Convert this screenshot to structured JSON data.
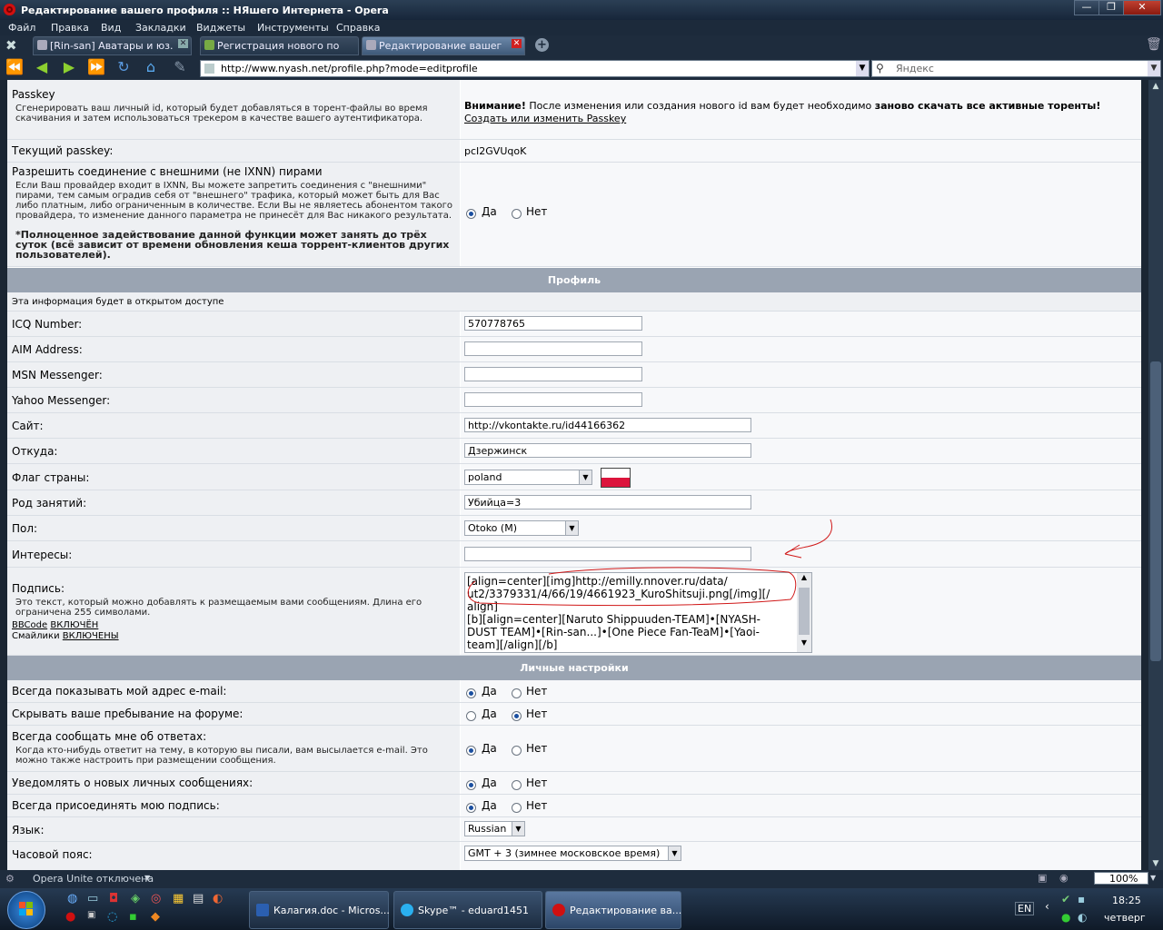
{
  "window": {
    "title": "Редактирование вашего профиля :: НЯшего Интернета - Opera"
  },
  "menu": [
    "Файл",
    "Правка",
    "Вид",
    "Закладки",
    "Виджеты",
    "Инструменты",
    "Справка"
  ],
  "tabs": [
    {
      "label": "[Rin-san] Аватары и юз..."
    },
    {
      "label": "Регистрация нового по..."
    },
    {
      "label": "Редактирование вашег..."
    }
  ],
  "address": {
    "url": "http://www.nyash.net/profile.php?mode=editprofile",
    "search_placeholder": "Яндекс"
  },
  "passkey": {
    "label": "Passkey",
    "desc": "Сгенерировать ваш личный id, который будет добавляться в торент-файлы во время скачивания и затем использоваться трекером в качестве вашего аутентификатора.",
    "warning_bold": "Внимание!",
    "warning_text": " После изменения или создания нового id вам будет необходимо ",
    "warning_bold2": "заново скачать все активные торенты!",
    "link": "Создать или изменить Passkey",
    "current_label": "Текущий passkey:",
    "current_value": "pcI2GVUqoK"
  },
  "external_peers": {
    "label": "Разрешить соединение с внешними (не IXNN) пирами",
    "desc": "Если Ваш провайдер входит в IXNN, Вы можете запретить соединения с \"внешними\" пирами, тем самым оградив себя от \"внешнего\" трафика, который может быть для Вас либо платным, либо ограниченным в количестве. Если Вы не являетесь абонентом такого провайдера, то изменение данного параметра не принесёт для Вас никакого результата.",
    "note": "*Полноценное задействование данной функции может занять до трёх суток (всё зависит от времени обновления кеша торрент-клиентов других пользователей).",
    "yes": "Да",
    "no": "Нет"
  },
  "profile": {
    "section": "Профиль",
    "public_note": "Эта информация будет в открытом доступе",
    "icq_label": "ICQ Number:",
    "icq": "570778765",
    "aim_label": "AIM Address:",
    "aim": "",
    "msn_label": "MSN Messenger:",
    "msn": "",
    "yahoo_label": "Yahoo Messenger:",
    "yahoo": "",
    "site_label": "Сайт:",
    "site": "http://vkontakte.ru/id44166362",
    "from_label": "Откуда:",
    "from": "Дзержинск",
    "flag_label": "Флаг страны:",
    "flag": "poland",
    "occ_label": "Род занятий:",
    "occ": "Убийца=3",
    "gender_label": "Пол:",
    "gender": "Otoko (M)",
    "interests_label": "Интересы:",
    "interests": "",
    "sig_label": "Подпись:",
    "sig_desc": "Это текст, который можно добавлять к размещаемым вами сообщениям. Длина его ограничена 255 символами.",
    "bbcode": "BBCode",
    "bbcode_state": "ВКЛЮЧЁН",
    "smilies": "Смайлики",
    "smilies_state": "ВКЛЮЧЕНЫ",
    "sig_lines": [
      "[align=center][img]http://emilly.nnover.ru/data/",
      "ut2/3379331/4/66/19/4661923_KuroShitsuji.png[/img][/",
      "align]",
      "[b][align=center][Naruto Shippuuden-TEAM]•[NYASH-",
      "DUST TEAM]•[Rin-san...]•[One Piece Fan-TeaM]•[Yaoi-",
      "team][/align][/b]"
    ]
  },
  "personal": {
    "section": "Личные настройки",
    "show_email": "Всегда показывать мой адрес e-mail:",
    "hide_online": "Скрывать ваше пребывание на форуме:",
    "notify_replies": "Всегда сообщать мне об ответах:",
    "notify_desc": "Когда кто-нибудь ответит на тему, в которую вы писали, вам высылается e-mail. Это можно также настроить при размещении сообщения.",
    "notify_pm": "Уведомлять о новых личных сообщениях:",
    "attach_sig": "Всегда присоединять мою подпись:",
    "lang_label": "Язык:",
    "lang": "Russian",
    "tz_label": "Часовой пояс:",
    "tz": "GMT + 3 (зимнее московское время)",
    "yes": "Да",
    "no": "Нет"
  },
  "statusbar": {
    "unite": "Opera Unite отключена",
    "zoom": "100%"
  },
  "taskbar": {
    "tasks": [
      "Калагия.doc - Micros...",
      "Skype™ - eduard1451",
      "Редактирование ва..."
    ],
    "lang": "EN",
    "time": "18:25",
    "day": "четверг"
  },
  "colors": {
    "section_header": "#9aa4b2",
    "annotation": "#d01818"
  }
}
